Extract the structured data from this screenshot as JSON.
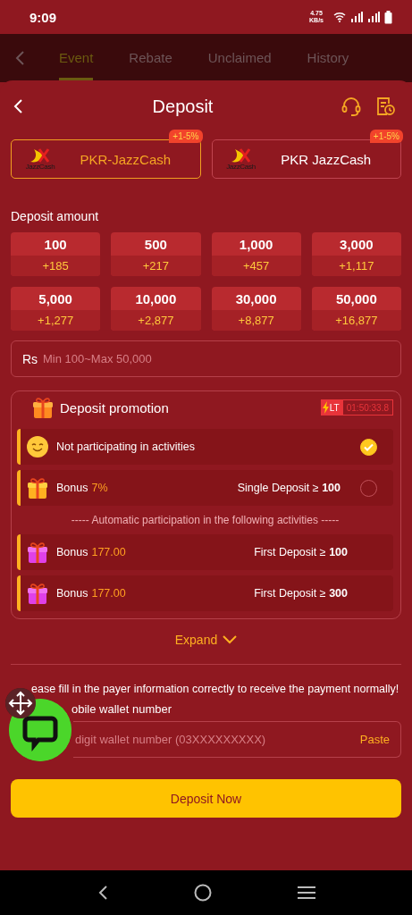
{
  "status_bar": {
    "time": "9:09",
    "speed": "4.75",
    "speed_unit": "KB/s"
  },
  "tabs": [
    {
      "label": "Event",
      "selected": true
    },
    {
      "label": "Rebate",
      "selected": false
    },
    {
      "label": "Unclaimed",
      "selected": false
    },
    {
      "label": "History",
      "selected": false
    }
  ],
  "sheet": {
    "title": "Deposit",
    "methods": [
      {
        "name": "PKR-JazzCash",
        "logo_text": "JazzCash",
        "badge": "+1-5%",
        "selected": true
      },
      {
        "name": "PKR JazzCash",
        "logo_text": "JazzCash",
        "badge": "+1-5%",
        "selected": false
      }
    ],
    "amount_label": "Deposit amount",
    "amounts": [
      {
        "amount": "100",
        "bonus": "+185"
      },
      {
        "amount": "500",
        "bonus": "+217"
      },
      {
        "amount": "1,000",
        "bonus": "+457"
      },
      {
        "amount": "3,000",
        "bonus": "+1,117"
      },
      {
        "amount": "5,000",
        "bonus": "+1,277"
      },
      {
        "amount": "10,000",
        "bonus": "+2,877"
      },
      {
        "amount": "30,000",
        "bonus": "+8,877"
      },
      {
        "amount": "50,000",
        "bonus": "+16,877"
      }
    ],
    "amount_field": {
      "currency": "Rs",
      "placeholder": "Min 100~Max 50,000"
    },
    "promotion": {
      "title": "Deposit promotion",
      "timer_tag": "LT",
      "timer": "01:50:33.8",
      "options": [
        {
          "kind": "none",
          "label": "Not participating in activities",
          "selected": true
        },
        {
          "kind": "bonus",
          "label": "Bonus",
          "value": "7%",
          "condition": "Single Deposit ≥ **100**",
          "selected": false
        }
      ],
      "auto_note": "----- Automatic participation in the following activities -----",
      "auto": [
        {
          "label": "Bonus",
          "value": "177.00",
          "condition": "First Deposit ≥ **100**"
        },
        {
          "label": "Bonus",
          "value": "177.00",
          "condition": "First Deposit ≥ **300**"
        }
      ]
    },
    "expand": "Expand",
    "notice": "ease fill in the payer information correctly to receive the payment normally!",
    "wallet_label": "obile wallet number",
    "wallet_field": {
      "placeholder": "digit wallet number (03XXXXXXXXX)",
      "action": "Paste"
    },
    "submit": "Deposit Now"
  }
}
